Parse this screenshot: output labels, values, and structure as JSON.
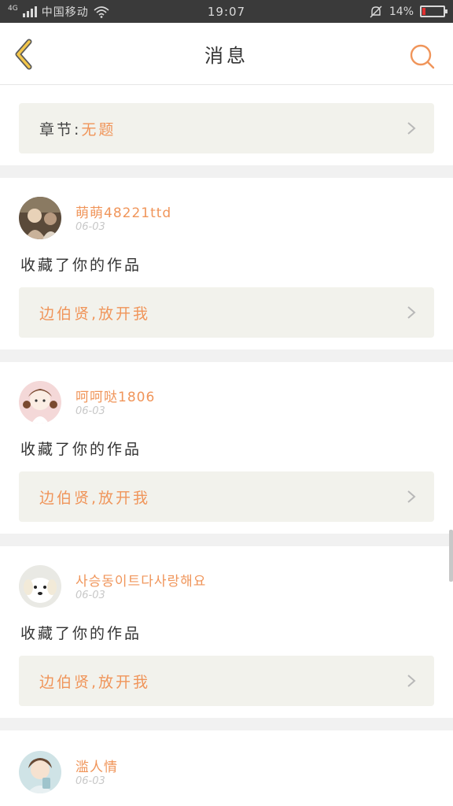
{
  "status_bar": {
    "network": "4G",
    "carrier": "中国移动",
    "time": "19:07",
    "battery": "14%",
    "battery_level": 0.14,
    "battery_color": "#e03030"
  },
  "header": {
    "title": "消息",
    "back_icon": "chevron-left-icon",
    "search_icon": "search-icon",
    "accent_color": "#f0955a"
  },
  "partial_card": {
    "chapter_label": "章节:",
    "chapter_value": "无题"
  },
  "messages": [
    {
      "user": "萌萌48221ttd",
      "date": "06-03",
      "action": "收藏了你的作品",
      "work_title": "边伯贤,放开我"
    },
    {
      "user": "呵呵哒1806",
      "date": "06-03",
      "action": "收藏了你的作品",
      "work_title": "边伯贤,放开我"
    },
    {
      "user": "사승동이트다사랑해요",
      "date": "06-03",
      "action": "收藏了你的作品",
      "work_title": "边伯贤,放开我"
    },
    {
      "user": "滥人情",
      "date": "06-03"
    }
  ]
}
